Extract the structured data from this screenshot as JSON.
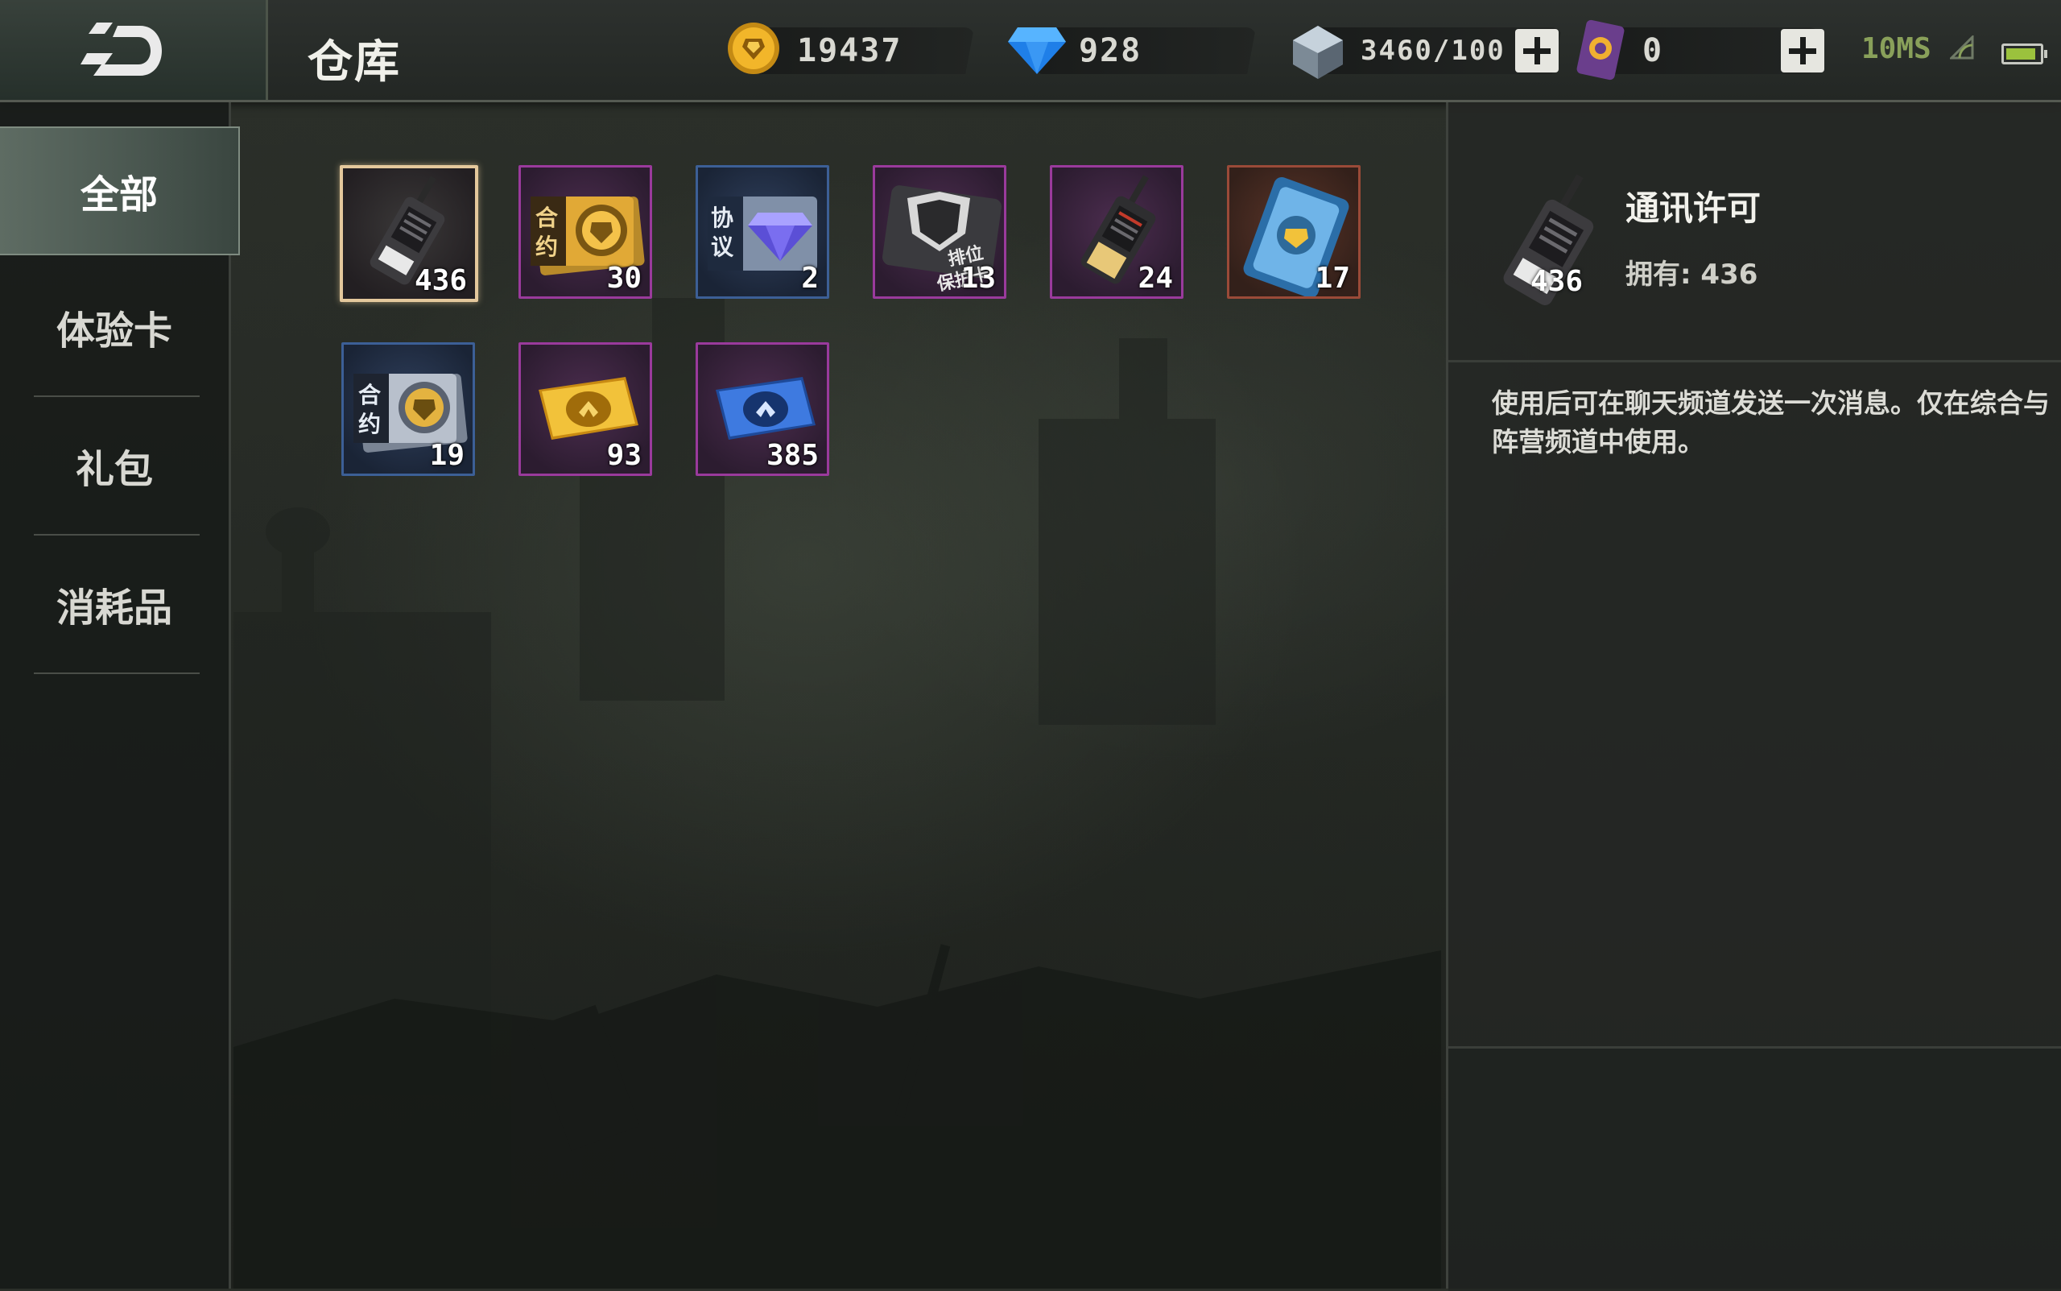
{
  "header": {
    "title": "仓库",
    "back_icon": "back-arrow-icon",
    "currencies": [
      {
        "name": "gold",
        "icon": "gold-coin-icon",
        "value": "19437"
      },
      {
        "name": "diamond",
        "icon": "blue-diamond-icon",
        "value": "928"
      },
      {
        "name": "crystal",
        "icon": "crystal-icon",
        "value": "3460/100"
      },
      {
        "name": "card",
        "icon": "purple-card-icon",
        "value": "0"
      }
    ],
    "ping": "10MS",
    "battery_level": 0.85
  },
  "sidebar": {
    "tabs": [
      {
        "label": "全部",
        "active": true
      },
      {
        "label": "体验卡",
        "active": false
      },
      {
        "label": "礼包",
        "active": false
      },
      {
        "label": "消耗品",
        "active": false
      }
    ]
  },
  "items": [
    {
      "icon": "walkie-talkie-icon",
      "count": "436",
      "quality": "select"
    },
    {
      "icon": "contract-gold-icon",
      "count": "30",
      "quality": "purple",
      "badge": "合约"
    },
    {
      "icon": "agreement-diamond-icon",
      "count": "2",
      "quality": "blue",
      "badge": "协议"
    },
    {
      "icon": "rank-protect-card-icon",
      "count": "13",
      "quality": "purple",
      "badge": "排位保护卡"
    },
    {
      "icon": "walkie-talkie-gold-icon",
      "count": "24",
      "quality": "purple"
    },
    {
      "icon": "chip-card-icon",
      "count": "17",
      "quality": "red"
    },
    {
      "icon": "contract-silver-icon",
      "count": "19",
      "quality": "blue",
      "badge": "合约"
    },
    {
      "icon": "gold-ticket-icon",
      "count": "93",
      "quality": "purple"
    },
    {
      "icon": "blue-ticket-icon",
      "count": "385",
      "quality": "purple"
    }
  ],
  "detail": {
    "name": "通讯许可",
    "owned": "拥有: 436",
    "count": "436",
    "description": "使用后可在聊天频道发送一次消息。仅在综合与阵营频道中使用。"
  }
}
